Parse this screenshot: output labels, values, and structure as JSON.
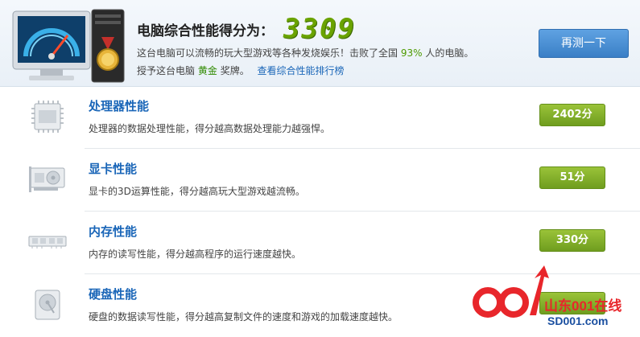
{
  "header": {
    "score_label": "电脑综合性能得分为：",
    "score_value": "3309",
    "desc_prefix": "这台电脑可以流畅的玩大型游戏等各种发烧娱乐！击败了全国",
    "desc_percent": "93%",
    "desc_suffix": "人的电脑。",
    "award_prefix": "授予这台电脑",
    "award_medal": "黄金",
    "award_suffix": "奖牌。",
    "ranking_link": "查看综合性能排行榜",
    "retest_label": "再测一下"
  },
  "rows": [
    {
      "title": "处理器性能",
      "desc": "处理器的数据处理性能，得分越高数据处理能力越强悍。",
      "score": "2402分",
      "icon": "cpu-icon"
    },
    {
      "title": "显卡性能",
      "desc": "显卡的3D运算性能，得分越高玩大型游戏越流畅。",
      "score": "51分",
      "icon": "graphics-card-icon"
    },
    {
      "title": "内存性能",
      "desc": "内存的读写性能，得分越高程序的运行速度越快。",
      "score": "330分",
      "icon": "memory-icon"
    },
    {
      "title": "硬盘性能",
      "desc": "硬盘的数据读写性能，得分越高复制文件的速度和游戏的加载速度越快。",
      "score": "",
      "icon": "hard-disk-icon"
    }
  ],
  "watermark": {
    "line1": "山东001在线",
    "line2": "SD001.com"
  },
  "colors": {
    "accent_blue": "#1a66b8",
    "score_green": "#6aa300",
    "button_blue": "#3a7fc6"
  }
}
